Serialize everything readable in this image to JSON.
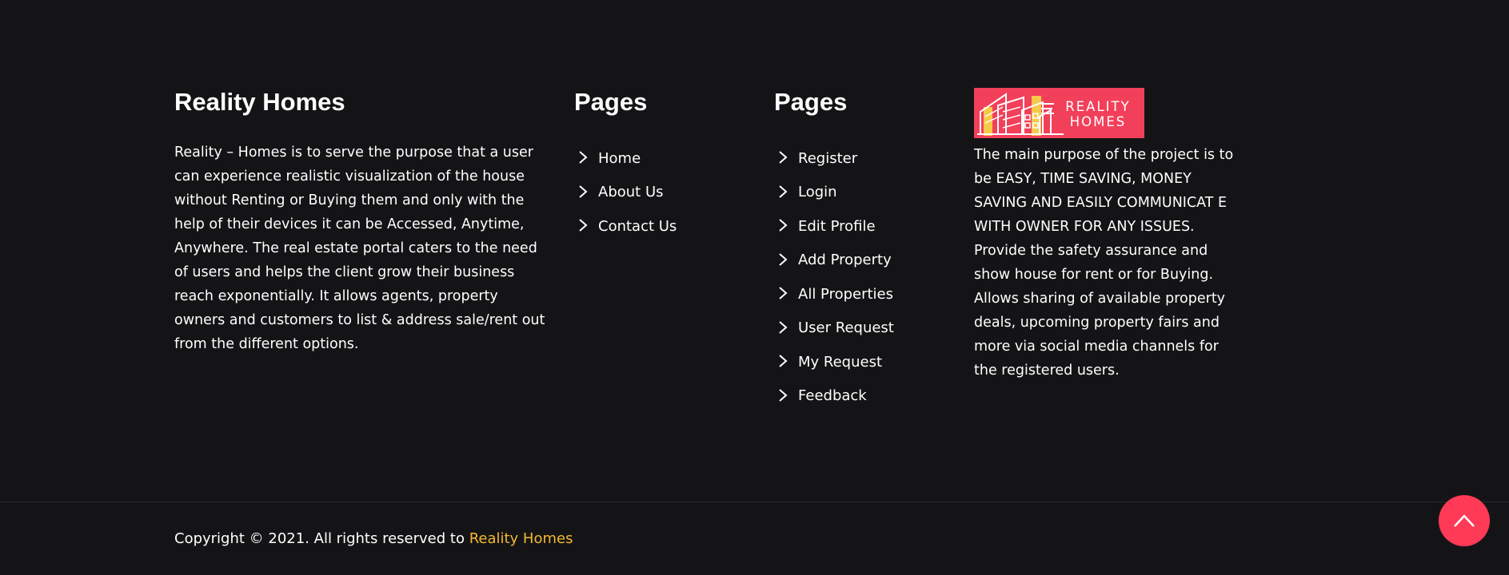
{
  "about": {
    "title": "Reality Homes",
    "text": "Reality – Homes is to serve the purpose that a user can experience realistic visualization of the house without Renting or Buying them and only with the help of their devices it can be Accessed, Anytime, Anywhere. The real estate portal caters to the need of users and helps the client grow their business reach exponentially. It allows agents, property owners and customers to list & address sale/rent out from the different options."
  },
  "pages_primary": {
    "title": "Pages",
    "links": [
      {
        "label": "Home"
      },
      {
        "label": "About Us"
      },
      {
        "label": "Contact Us"
      }
    ]
  },
  "pages_secondary": {
    "title": "Pages",
    "links": [
      {
        "label": "Register"
      },
      {
        "label": "Login"
      },
      {
        "label": "Edit Profile"
      },
      {
        "label": "Add Property"
      },
      {
        "label": "All Properties"
      },
      {
        "label": "User Request"
      },
      {
        "label": "My Request"
      },
      {
        "label": "Feedback"
      }
    ]
  },
  "purpose": {
    "logo_line1": "REALITY",
    "logo_line2": "HOMES",
    "text": "The main purpose of the project is to be EASY, TIME SAVING, MONEY SAVING AND EASILY COMMUNICAT E WITH OWNER FOR ANY ISSUES. Provide the safety assurance and show house for rent or for Buying. Allows sharing of available property deals, upcoming property fairs and more via social media channels for the registered users."
  },
  "footer": {
    "copyright_prefix": "Copyright © 2021. All rights reserved to ",
    "brand": "Reality Homes"
  },
  "icons": {
    "link_chevron": "chevron-right-icon",
    "scroll_top": "chevron-up-icon"
  },
  "colors": {
    "background": "#141416",
    "brand_accent": "#f5b731",
    "scroll_button": "#fe3a57",
    "logo_background": "#f2405a"
  }
}
